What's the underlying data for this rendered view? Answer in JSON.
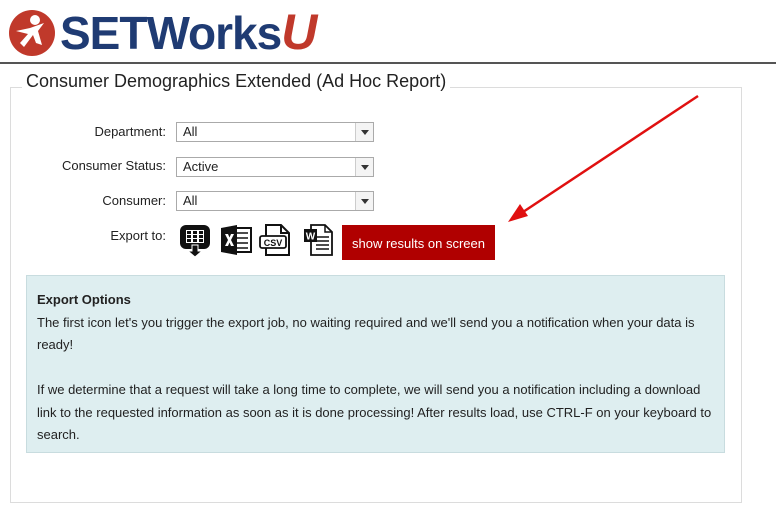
{
  "brand": {
    "logo_text_main": "SETWorks",
    "logo_text_accent": "U"
  },
  "page": {
    "title": "Consumer Demographics Extended (Ad Hoc Report)"
  },
  "filters": {
    "department": {
      "label": "Department:",
      "value": "All"
    },
    "consumer_status": {
      "label": "Consumer Status:",
      "value": "Active"
    },
    "consumer": {
      "label": "Consumer:",
      "value": "All"
    }
  },
  "export": {
    "label": "Export to:",
    "icons": [
      "export-job-icon",
      "excel-icon",
      "csv-icon",
      "word-icon"
    ],
    "show_button": "show results on screen"
  },
  "info": {
    "heading": "Export Options",
    "line1": "The first icon let's you trigger the export job, no waiting required and we'll send you a notification when your data is ready!",
    "line2": "If we determine that a request will take a long time to complete, we will send you a notification including a download link to the requested information as soon as it is done processing! After results load, use CTRL-F on your keyboard to search."
  },
  "colors": {
    "brand_blue": "#1f3b73",
    "brand_red": "#c0392b",
    "button_red": "#b00000",
    "info_bg": "#deeef0",
    "annotation_arrow": "#e01010"
  }
}
